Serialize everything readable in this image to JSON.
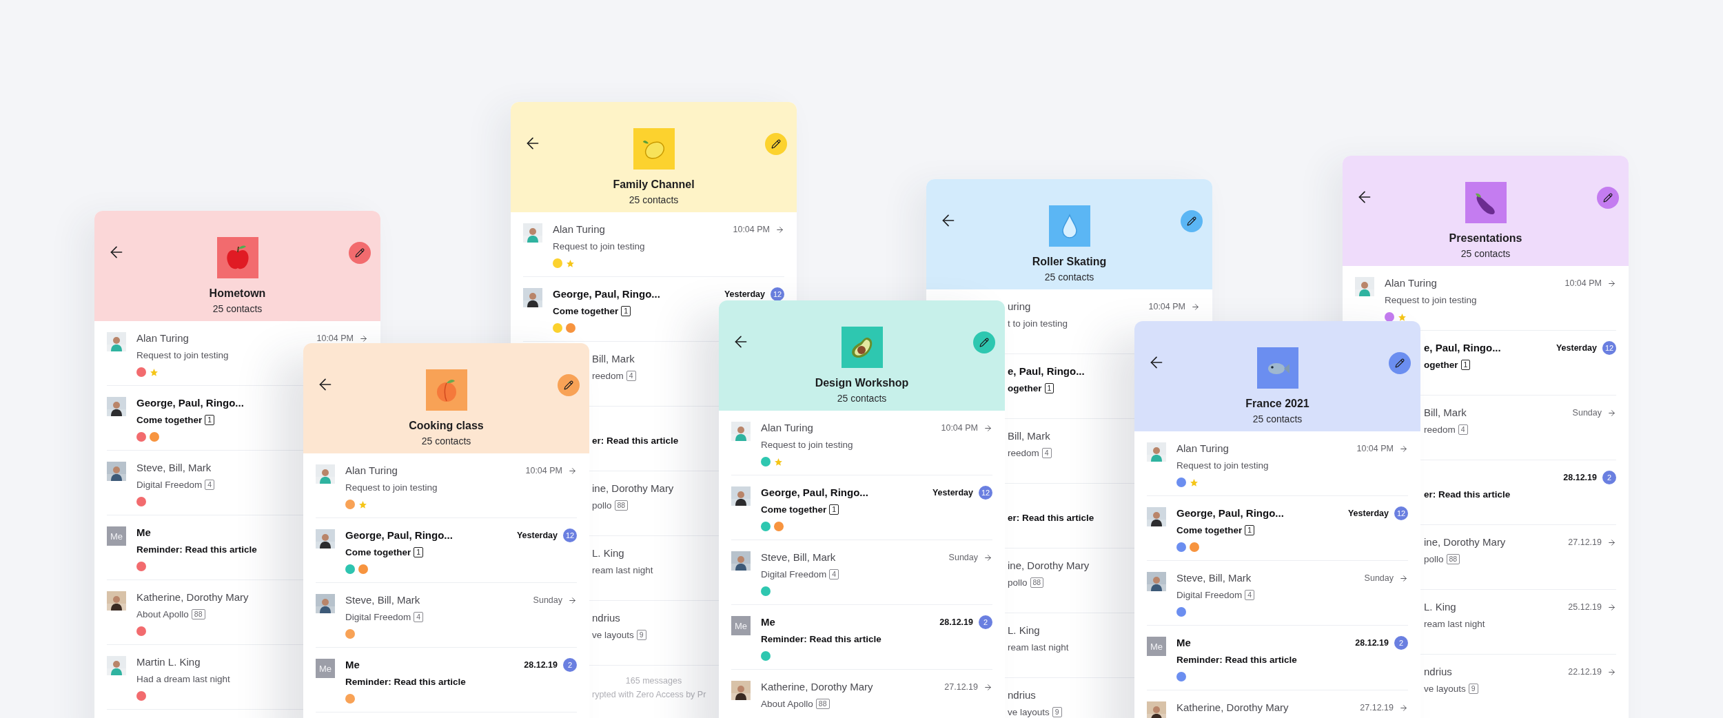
{
  "groups": [
    {
      "title": "Hometown",
      "subtitle": "25 contacts",
      "color": "#f26b6e",
      "messages": [
        {
          "kind": "full",
          "name": "Alan Turing",
          "preview": "Request to join testing",
          "time": "10:04 PM",
          "unread": false,
          "starred": true,
          "dots": [
            {
              "color": "#f26b6e"
            }
          ]
        },
        {
          "kind": "full",
          "name": "George, Paul, Ringo...",
          "preview": "Come together",
          "count": "1",
          "unread": true,
          "starred": false,
          "dots": [
            {
              "color": "#f26b6e"
            },
            {
              "color": "#f7943f"
            }
          ]
        },
        {
          "kind": "full",
          "name": "Steve, Bill, Mark",
          "preview": "Digital Freedom",
          "count": "4",
          "unread": false,
          "starred": false,
          "dots": [
            {
              "color": "#f26b6e"
            }
          ]
        },
        {
          "kind": "full",
          "avatar_text": "Me",
          "name": "Me",
          "preview": "Reminder: Read this article",
          "unread": true,
          "starred": false,
          "dots": [
            {
              "color": "#f26b6e"
            }
          ]
        },
        {
          "kind": "full",
          "name": "Katherine, Dorothy Mary",
          "preview": "About Apollo",
          "count": "88",
          "unread": false,
          "starred": false,
          "dots": [
            {
              "color": "#f26b6e"
            }
          ]
        },
        {
          "kind": "full",
          "name": "Martin L. King",
          "preview": "Had a dream last night",
          "unread": false,
          "starred": false,
          "dots": [
            {
              "color": "#f26b6e"
            }
          ]
        }
      ]
    },
    {
      "title": "Cooking class",
      "subtitle": "25 contacts",
      "color": "#f8a256",
      "messages": [
        {
          "kind": "full",
          "name": "Alan Turing",
          "preview": "Request to join testing",
          "time": "10:04 PM",
          "unread": false,
          "starred": true,
          "dots": [
            {
              "color": "#f8a256"
            }
          ]
        },
        {
          "kind": "full",
          "name": "George, Paul, Ringo...",
          "preview": "Come together",
          "count": "1",
          "time": "Yesterday",
          "badge": "12",
          "unread": true,
          "starred": false,
          "dots": [
            {
              "color": "#2ec4b0"
            },
            {
              "color": "#f7943f"
            }
          ]
        },
        {
          "kind": "full",
          "name": "Steve, Bill, Mark",
          "preview": "Digital Freedom",
          "count": "4",
          "time": "Sunday",
          "unread": false,
          "starred": false,
          "dots": [
            {
              "color": "#f8a256"
            }
          ]
        },
        {
          "kind": "full",
          "avatar_text": "Me",
          "name": "Me",
          "preview": "Reminder: Read this article",
          "time": "28.12.19",
          "badge": "2",
          "unread": true,
          "starred": false,
          "dots": [
            {
              "color": "#f8a256"
            }
          ]
        }
      ]
    },
    {
      "title": "Family Channel",
      "subtitle": "25 contacts",
      "color": "#fcd22e",
      "messages": [
        {
          "kind": "full",
          "name": "Alan Turing",
          "preview": "Request to join testing",
          "time": "10:04 PM",
          "unread": false,
          "starred": true,
          "dots": [
            {
              "color": "#fcd22e"
            }
          ]
        },
        {
          "kind": "full",
          "name": "George, Paul, Ringo...",
          "preview": "Come together",
          "count": "1",
          "time": "Yesterday",
          "badge": "12",
          "unread": true,
          "starred": false,
          "dots": [
            {
              "color": "#fcd22e"
            },
            {
              "color": "#f7943f"
            }
          ]
        },
        {
          "kind": "clipped",
          "name": "Bill, Mark",
          "preview": "reedom",
          "count": "4",
          "unread": false
        },
        {
          "kind": "clipped",
          "preview": "er: Read this article",
          "unread": true
        },
        {
          "kind": "clipped",
          "name": "ine, Dorothy Mary",
          "preview": "pollo",
          "count": "88",
          "unread": false
        },
        {
          "kind": "clipped",
          "name": "L. King",
          "preview": "ream last night",
          "unread": false
        },
        {
          "kind": "clipped",
          "name": "ndrius",
          "preview": "ve layouts",
          "count": "9",
          "unread": false
        }
      ],
      "footer": {
        "count": "165 messages",
        "note": "rypted with Zero Access by Pr"
      }
    },
    {
      "title": "Design Workshop",
      "subtitle": "25 contacts",
      "color": "#2ec7b0",
      "messages": [
        {
          "kind": "full",
          "name": "Alan Turing",
          "preview": "Request to join testing",
          "time": "10:04 PM",
          "unread": false,
          "starred": true,
          "dots": [
            {
              "color": "#2ec7b0"
            }
          ]
        },
        {
          "kind": "full",
          "name": "George, Paul, Ringo...",
          "preview": "Come together",
          "count": "1",
          "time": "Yesterday",
          "badge": "12",
          "unread": true,
          "starred": false,
          "dots": [
            {
              "color": "#2ec7b0"
            },
            {
              "color": "#f7943f"
            }
          ]
        },
        {
          "kind": "full",
          "name": "Steve, Bill, Mark",
          "preview": "Digital Freedom",
          "count": "4",
          "time": "Sunday",
          "unread": false,
          "starred": false,
          "dots": [
            {
              "color": "#2ec7b0"
            }
          ]
        },
        {
          "kind": "full",
          "avatar_text": "Me",
          "name": "Me",
          "preview": "Reminder: Read this article",
          "time": "28.12.19",
          "badge": "2",
          "unread": true,
          "starred": false,
          "dots": [
            {
              "color": "#2ec7b0"
            }
          ]
        },
        {
          "kind": "full",
          "name": "Katherine, Dorothy Mary",
          "preview": "About Apollo",
          "count": "88",
          "time": "27.12.19",
          "unread": false,
          "starred": false
        }
      ]
    },
    {
      "title": "Roller Skating",
      "subtitle": "25 contacts",
      "color": "#5bb6f4",
      "messages": [
        {
          "kind": "clipped",
          "name": "uring",
          "preview": "t to join testing",
          "time": "10:04 PM",
          "unread": false
        },
        {
          "kind": "clipped",
          "name": "e, Paul, Ringo...",
          "preview": "ogether",
          "count": "1",
          "unread": true
        },
        {
          "kind": "clipped",
          "name": "Bill, Mark",
          "preview": "reedom",
          "count": "4",
          "unread": false
        },
        {
          "kind": "clipped",
          "preview": "er: Read this article",
          "unread": true
        },
        {
          "kind": "clipped",
          "name": "ine, Dorothy Mary",
          "preview": "pollo",
          "count": "88",
          "unread": false
        },
        {
          "kind": "clipped",
          "name": "L. King",
          "preview": "ream last night",
          "unread": false
        },
        {
          "kind": "clipped",
          "name": "ndrius",
          "preview": "ve layouts",
          "count": "9",
          "unread": false
        }
      ]
    },
    {
      "title": "France 2021",
      "subtitle": "25 contacts",
      "color": "#6b8ef0",
      "messages": [
        {
          "kind": "full",
          "name": "Alan Turing",
          "preview": "Request to join testing",
          "time": "10:04 PM",
          "unread": false,
          "starred": true,
          "dots": [
            {
              "color": "#6b8ef0"
            }
          ]
        },
        {
          "kind": "full",
          "name": "George, Paul, Ringo...",
          "preview": "Come together",
          "count": "1",
          "time": "Yesterday",
          "badge": "12",
          "unread": true,
          "starred": false,
          "dots": [
            {
              "color": "#6b8ef0"
            },
            {
              "color": "#f7943f"
            }
          ]
        },
        {
          "kind": "full",
          "name": "Steve, Bill, Mark",
          "preview": "Digital Freedom",
          "count": "4",
          "time": "Sunday",
          "unread": false,
          "starred": false,
          "dots": [
            {
              "color": "#6b8ef0"
            }
          ]
        },
        {
          "kind": "full",
          "avatar_text": "Me",
          "name": "Me",
          "preview": "Reminder: Read this article",
          "time": "28.12.19",
          "badge": "2",
          "unread": true,
          "starred": false,
          "dots": [
            {
              "color": "#6b8ef0"
            }
          ]
        },
        {
          "kind": "full",
          "name": "Katherine, Dorothy Mary",
          "time": "27.12.19",
          "unread": false,
          "starred": false
        }
      ]
    },
    {
      "title": "Presentations",
      "subtitle": "25 contacts",
      "color": "#c47cf0",
      "messages": [
        {
          "kind": "full",
          "name": "Alan Turing",
          "preview": "Request to join testing",
          "time": "10:04 PM",
          "unread": false,
          "starred": true,
          "dots": [
            {
              "color": "#c47cf0"
            }
          ]
        },
        {
          "kind": "clipped",
          "name": "e, Paul, Ringo...",
          "preview": "ogether",
          "count": "1",
          "time": "Yesterday",
          "badge": "12",
          "unread": true
        },
        {
          "kind": "clipped",
          "name": "Bill, Mark",
          "preview": "reedom",
          "count": "4",
          "time": "Sunday",
          "unread": false
        },
        {
          "kind": "clipped",
          "preview": "er: Read this article",
          "time": "28.12.19",
          "badge": "2",
          "unread": true
        },
        {
          "kind": "clipped",
          "name": "ine, Dorothy Mary",
          "preview": "pollo",
          "count": "88",
          "time": "27.12.19",
          "unread": false
        },
        {
          "kind": "clipped",
          "name": "L. King",
          "preview": "ream last night",
          "time": "25.12.19",
          "unread": false
        },
        {
          "kind": "clipped",
          "name": "ndrius",
          "preview": "ve layouts",
          "count": "9",
          "time": "22.12.19",
          "unread": false
        }
      ]
    }
  ]
}
